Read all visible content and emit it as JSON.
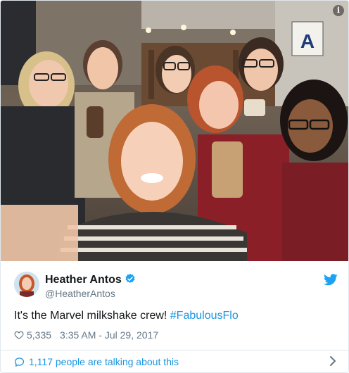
{
  "photo": {
    "description_icon": "info-icon",
    "sign_letter": "A"
  },
  "author": {
    "display_name": "Heather Antos",
    "handle": "@HeatherAntos",
    "verified_icon": "verified-badge-icon",
    "platform_icon": "twitter-bird-icon"
  },
  "tweet": {
    "text_plain": "It's the Marvel milkshake crew! ",
    "hashtag": "#FabulousFlo"
  },
  "meta": {
    "likes": "5,335",
    "timestamp": "3:35 AM - Jul 29, 2017"
  },
  "footer": {
    "talking_label": "1,117 people are talking about this"
  },
  "colors": {
    "link": "#1b95e0",
    "muted": "#657786",
    "text": "#14171a",
    "border": "#e1e8ed"
  }
}
